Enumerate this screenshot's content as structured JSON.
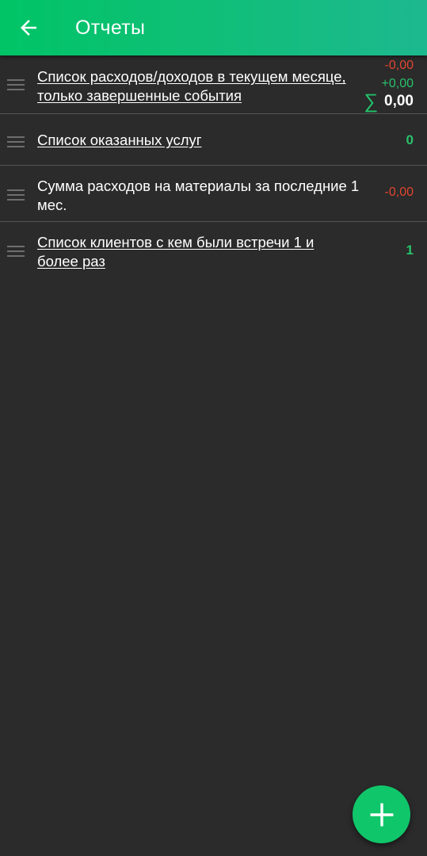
{
  "header": {
    "title": "Отчеты",
    "back_icon": "arrow-left-icon"
  },
  "reports": [
    {
      "label": "Список расходов/доходов в текущем месяце, только завершенные события",
      "is_link": true,
      "expense": "-0,00",
      "income": "+0,00",
      "sum_icon": "sigma-icon",
      "total": "0,00"
    },
    {
      "label": "Список оказанных услуг",
      "is_link": true,
      "value": "0"
    },
    {
      "label": "Сумма расходов на материалы за последние 1 мес.",
      "is_link": false,
      "value": "-0,00"
    },
    {
      "label": "Список клиентов с кем были встречи 1 и более раз",
      "is_link": true,
      "value": "1"
    }
  ],
  "fab": {
    "icon": "plus-icon"
  },
  "colors": {
    "header_start": "#00c466",
    "header_end": "#1db88f",
    "background": "#2b2b2b",
    "negative": "#e0452f",
    "positive": "#28c26a",
    "fab": "#10c66a"
  }
}
